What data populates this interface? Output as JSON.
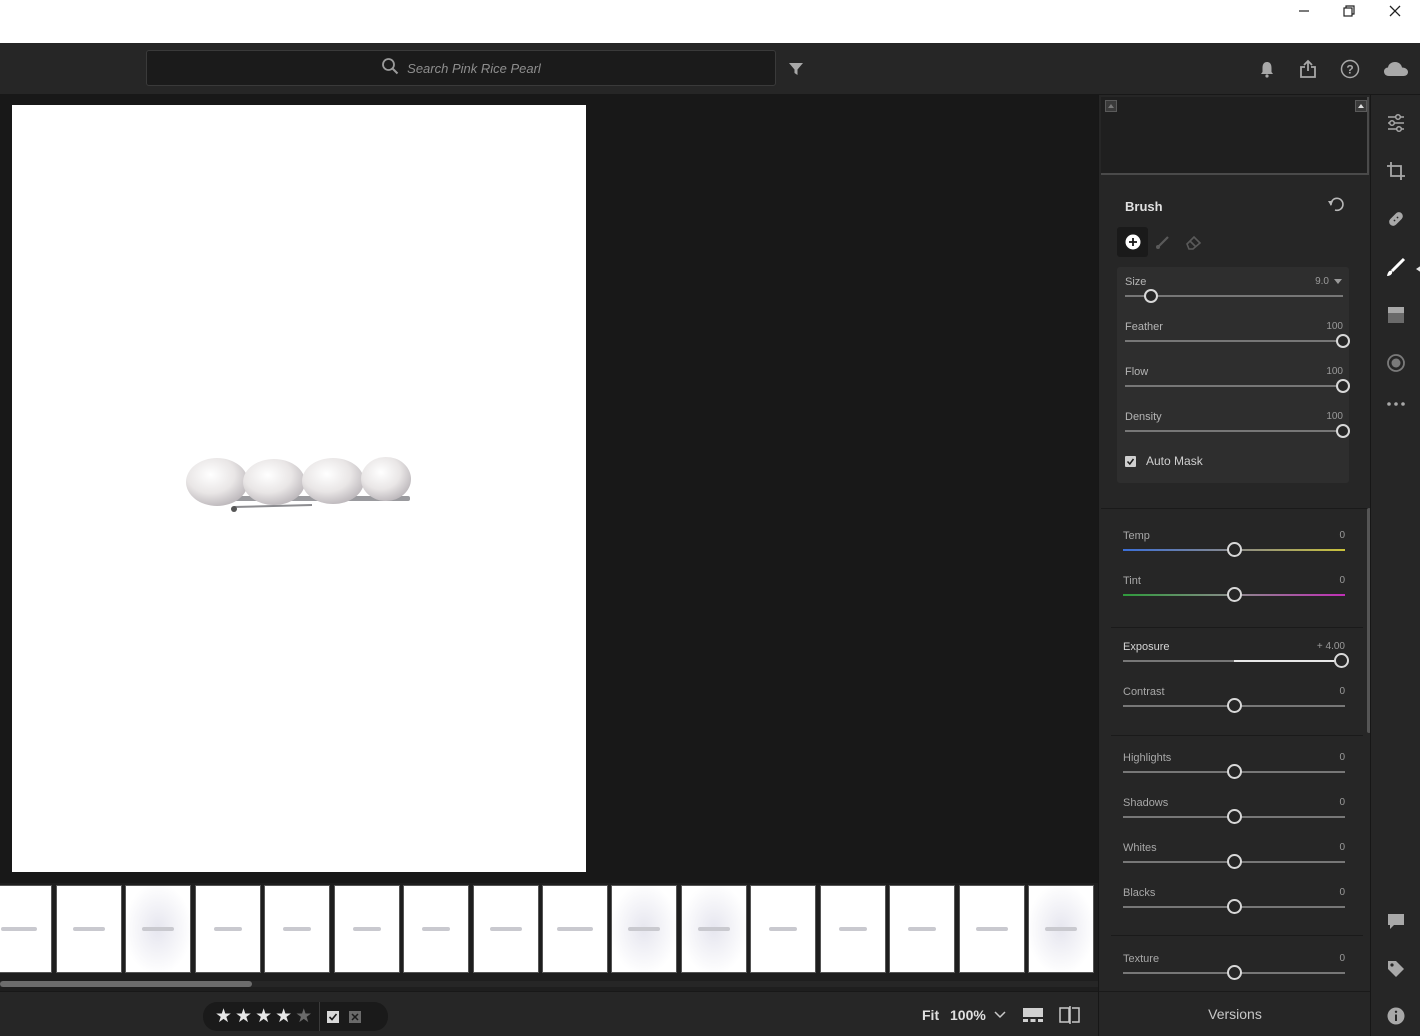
{
  "search": {
    "placeholder": "Search Pink Rice Pearl"
  },
  "icons": {
    "window": [
      "minimize-icon",
      "restore-icon",
      "close-icon"
    ],
    "topbar": [
      "filter-icon",
      "bell-icon",
      "share-icon",
      "help-icon",
      "cloud-icon"
    ],
    "toolbar": [
      "edit-sliders-icon",
      "crop-icon",
      "healing-icon",
      "brush-icon",
      "linear-gradient-icon",
      "radial-gradient-icon",
      "more-icon",
      "comment-icon",
      "tag-icon",
      "info-icon"
    ]
  },
  "brush": {
    "title": "Brush",
    "size": {
      "label": "Size",
      "value": "9.0",
      "level": 0.12
    },
    "feather": {
      "label": "Feather",
      "value": "100",
      "level": 1.0
    },
    "flow": {
      "label": "Flow",
      "value": "100",
      "level": 1.0
    },
    "density": {
      "label": "Density",
      "value": "100",
      "level": 1.0
    },
    "auto_mask": {
      "label": "Auto Mask",
      "checked": true
    }
  },
  "adjustments": {
    "temp": {
      "label": "Temp",
      "value": "0",
      "level": 0.5
    },
    "tint": {
      "label": "Tint",
      "value": "0",
      "level": 0.5
    },
    "exposure": {
      "label": "Exposure",
      "value": "+ 4.00",
      "level": 0.98
    },
    "contrast": {
      "label": "Contrast",
      "value": "0",
      "level": 0.5
    },
    "highlights": {
      "label": "Highlights",
      "value": "0",
      "level": 0.5
    },
    "shadows": {
      "label": "Shadows",
      "value": "0",
      "level": 0.5
    },
    "whites": {
      "label": "Whites",
      "value": "0",
      "level": 0.5
    },
    "blacks": {
      "label": "Blacks",
      "value": "0",
      "level": 0.5
    },
    "texture": {
      "label": "Texture",
      "value": "0",
      "level": 0.5
    }
  },
  "bottom": {
    "rating_stars": 4,
    "rating_max": 5,
    "fit_label": "Fit",
    "zoom_label": "100%"
  },
  "panel_footer": {
    "versions_label": "Versions"
  },
  "colors": {
    "accent": "#ffffff",
    "panel": "#262626",
    "canvas": "#181818",
    "temp_gradient": [
      "#3b6fd8",
      "#c9c23a"
    ],
    "tint_gradient": [
      "#2f9a3c",
      "#c02fb6"
    ]
  }
}
